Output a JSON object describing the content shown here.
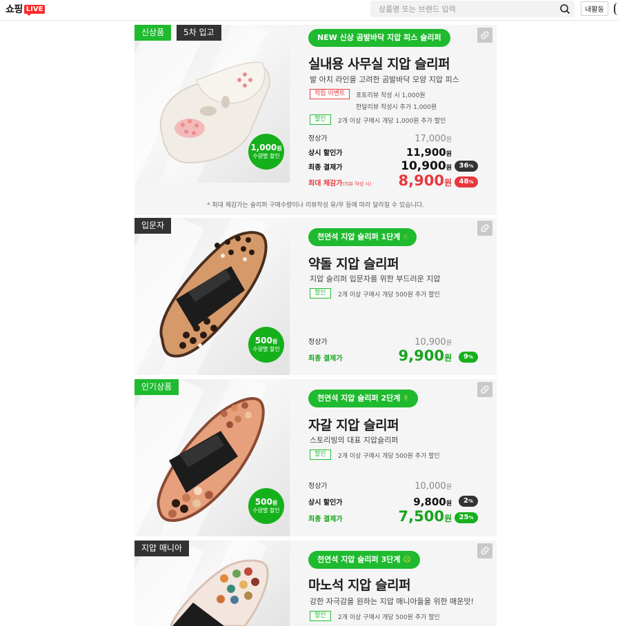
{
  "header": {
    "logo_text": "쇼핑",
    "logo_badge": "LIVE",
    "search_placeholder": "상품명 또는 브랜드 입력",
    "activity_label": "내활동",
    "search_icon": "search-icon"
  },
  "colors": {
    "accent_green": "#1fba2f",
    "sale_red": "#e8383d",
    "dark_tag": "#333333"
  },
  "products": [
    {
      "tags": [
        "신상품",
        "5차 입고"
      ],
      "qty_amount": "1,000",
      "qty_unit": "원",
      "qty_sub": "수량별 할인",
      "pill": "NEW 신상 곰발바닥 지압 피스 슬리퍼",
      "title": "실내용 사무실 지압 슬리퍼",
      "subtitle": "발 아치 라인을 고려한 곰발바닥 모양 지압 피스",
      "event_tag": "적립 이벤트",
      "event_note_1": "포토리뷰 작성 시 1,000원",
      "event_note_2": "한달리뷰 작성시 추가 1,000원",
      "discount_tag": "할인",
      "discount_note": "2개 이상 구매시 개당 1,000원 추가 할인",
      "prices": [
        {
          "label": "정상가",
          "value": "17,000",
          "unit": "원"
        },
        {
          "label": "상시 할인가",
          "value": "11,900",
          "unit": "원"
        },
        {
          "label": "최종 결제가",
          "value": "10,900",
          "unit": "원",
          "pct": "36",
          "pct_unit": "%"
        },
        {
          "label": "최대 체감가",
          "label_note": "(리뷰 작성 시)",
          "value": "8,900",
          "unit": "원",
          "pct": "48",
          "pct_unit": "%"
        }
      ],
      "footnote": "*  최대 체감가는 슬리퍼 구매수량이나 리뷰작성 유/무 등에 따라 달라질 수 있습니다."
    },
    {
      "tags": [
        "입문자"
      ],
      "qty_amount": "500",
      "qty_unit": "원",
      "qty_sub": "수량별 할인",
      "pill": "천연석 지압 슬리퍼 1단계",
      "pill_emoji": "☝",
      "title": "약돌 지압 슬리퍼",
      "subtitle": "지압 슬리퍼 입문자를 위한 부드러운 지압",
      "discount_tag": "할인",
      "discount_note": "2개 이상 구매시 개당 500원 추가 할인",
      "prices": [
        {
          "label": "정상가",
          "value": "10,900",
          "unit": "원"
        },
        {
          "label": "최종 결제가",
          "value": "9,900",
          "unit": "원",
          "pct": "9",
          "pct_unit": "%"
        }
      ]
    },
    {
      "tags": [
        "인기상품"
      ],
      "qty_amount": "500",
      "qty_unit": "원",
      "qty_sub": "수량별 할인",
      "pill": "천연석 지압 슬리퍼 2단계",
      "pill_emoji": "✌",
      "title": "자갈 지압 슬리퍼",
      "subtitle": "스토리빙의 대표 지압슬리퍼",
      "discount_tag": "할인",
      "discount_note": "2개 이상 구매시 개당 500원 추가 할인",
      "prices": [
        {
          "label": "정상가",
          "value": "10,000",
          "unit": "원"
        },
        {
          "label": "상시 할인가",
          "value": "9,800",
          "unit": "원",
          "pct": "2",
          "pct_unit": "%"
        },
        {
          "label": "최종 결제가",
          "value": "7,500",
          "unit": "원",
          "pct": "25",
          "pct_unit": "%"
        }
      ]
    },
    {
      "tags": [
        "지압 매니아"
      ],
      "pill": "천연석 지압 슬리퍼 3단계",
      "pill_emoji": "☹",
      "title": "마노석 지압 슬리퍼",
      "subtitle": "강한 자극감을 원하는 지압 매니아들을 위한 매운맛!",
      "discount_tag": "할인",
      "discount_note": "2개 이상 구매시 개당 500원 추가 할인"
    }
  ]
}
